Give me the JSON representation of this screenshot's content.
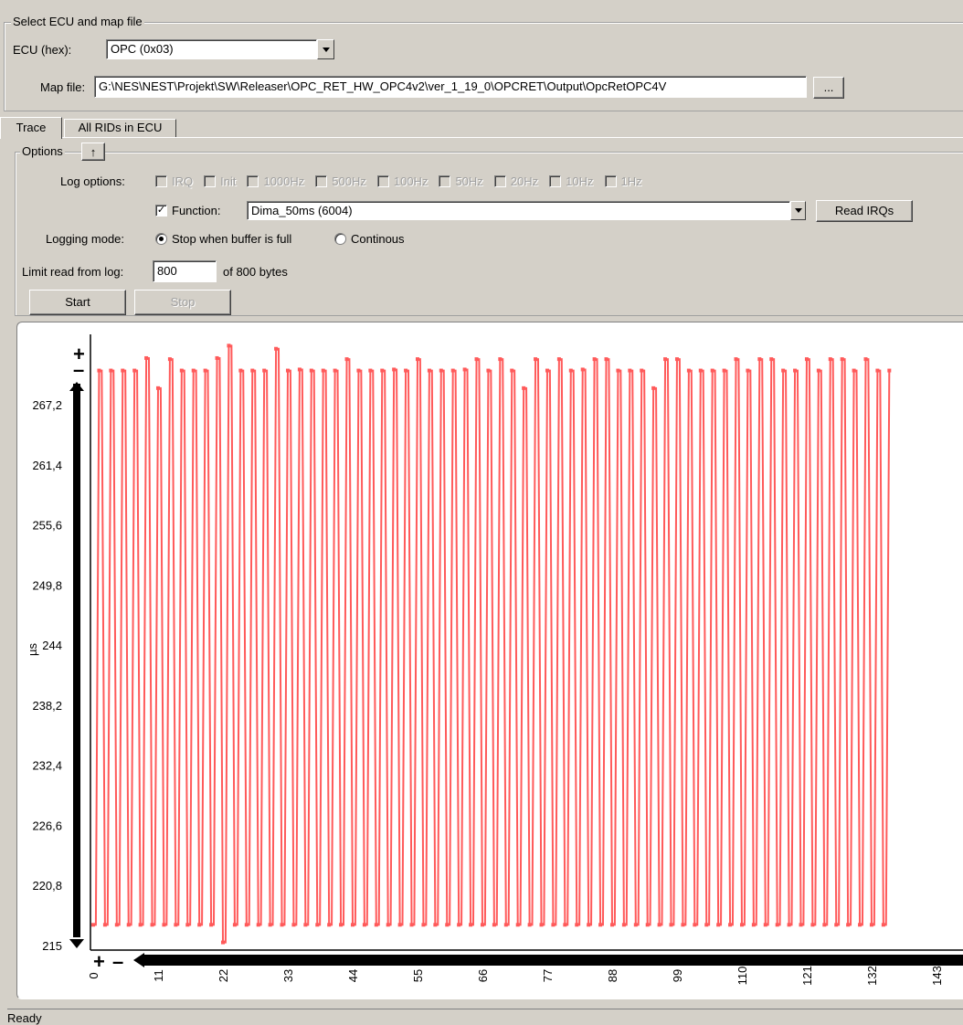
{
  "select_ecu": {
    "legend": "Select ECU and map file",
    "ecu_label": "ECU (hex):",
    "ecu_value": "OPC (0x03)",
    "map_label": "Map file:",
    "map_value": "G:\\NES\\NEST\\Projekt\\SW\\Releaser\\OPC_RET_HW_OPC4v2\\ver_1_19_0\\OPCRET\\Output\\OpcRetOPC4V",
    "browse_label": "..."
  },
  "tabs": [
    {
      "label": "Trace",
      "active": true
    },
    {
      "label": "All RIDs in ECU",
      "active": false
    }
  ],
  "options": {
    "legend": "Options",
    "collapse_glyph": "↑",
    "log_options_label": "Log options:",
    "log_options": [
      {
        "label": "IRQ",
        "checked": false,
        "enabled": false
      },
      {
        "label": "Init",
        "checked": false,
        "enabled": false
      },
      {
        "label": "1000Hz",
        "checked": false,
        "enabled": false
      },
      {
        "label": "500Hz",
        "checked": false,
        "enabled": false
      },
      {
        "label": "100Hz",
        "checked": false,
        "enabled": false
      },
      {
        "label": "50Hz",
        "checked": false,
        "enabled": false
      },
      {
        "label": "20Hz",
        "checked": false,
        "enabled": false
      },
      {
        "label": "10Hz",
        "checked": false,
        "enabled": false
      },
      {
        "label": "1Hz",
        "checked": false,
        "enabled": false
      }
    ],
    "function_label": "Function:",
    "function_checked": true,
    "function_value": "Dima_50ms (6004)",
    "read_irqs_label": "Read IRQs",
    "logging_mode_label": "Logging mode:",
    "logging_modes": [
      {
        "label": "Stop when buffer is full",
        "selected": true
      },
      {
        "label": "Continous",
        "selected": false
      }
    ],
    "limit_label": "Limit read from log:",
    "limit_value": "800",
    "limit_suffix": "of 800 bytes",
    "start_label": "Start",
    "stop_label": "Stop"
  },
  "chart_data": {
    "type": "line",
    "ylabel": "µs",
    "xlabel": "",
    "ylim": [
      215,
      272
    ],
    "xlim": [
      0,
      146
    ],
    "ytick_labels": [
      "267,2",
      "261,4",
      "255,6",
      "249,8",
      "244",
      "238,2",
      "232,4",
      "226,6",
      "220,8",
      "215"
    ],
    "xtick_labels": [
      "0",
      "11",
      "22",
      "33",
      "44",
      "55",
      "66",
      "77",
      "88",
      "99",
      "110",
      "121",
      "132",
      "143"
    ],
    "series_color": "#ff5a5a",
    "series": [
      {
        "values": [
          217,
          270.5,
          217,
          270.5,
          217,
          270.5,
          217,
          270.5,
          217,
          271.7,
          217,
          268.8,
          217,
          271.6,
          217,
          270.5,
          217,
          270.5,
          217,
          270.5,
          217,
          271.7,
          215.3,
          272.9,
          217,
          270.5,
          217,
          270.5,
          217,
          270.5,
          217,
          272.6,
          217,
          270.5,
          217,
          270.6,
          217,
          270.5,
          217,
          270.5,
          217,
          270.5,
          217,
          271.6,
          217,
          270.5,
          217,
          270.5,
          217,
          270.5,
          217,
          270.6,
          217,
          270.5,
          217,
          271.6,
          217,
          270.5,
          217,
          270.5,
          217,
          270.5,
          217,
          270.6,
          217,
          271.6,
          217,
          270.5,
          217,
          271.6,
          217,
          270.5,
          217,
          268.8,
          217,
          271.6,
          217,
          270.5,
          217,
          271.6,
          217,
          270.5,
          217,
          270.6,
          217,
          271.6,
          217,
          271.6,
          217,
          270.5,
          217,
          270.5,
          217,
          270.5,
          217,
          268.8,
          217,
          271.6,
          217,
          271.6,
          217,
          270.5,
          217,
          270.5,
          217,
          270.5,
          217,
          270.5,
          217,
          271.6,
          217,
          270.5,
          217,
          271.6,
          217,
          271.6,
          217,
          270.5,
          217,
          270.5,
          217,
          271.6,
          217,
          270.5,
          217,
          271.6,
          217,
          271.6,
          217,
          270.5,
          217,
          271.6,
          217,
          270.5,
          217,
          270.5
        ]
      }
    ],
    "grid": false,
    "legend": "none"
  },
  "status": {
    "text": "Ready"
  }
}
